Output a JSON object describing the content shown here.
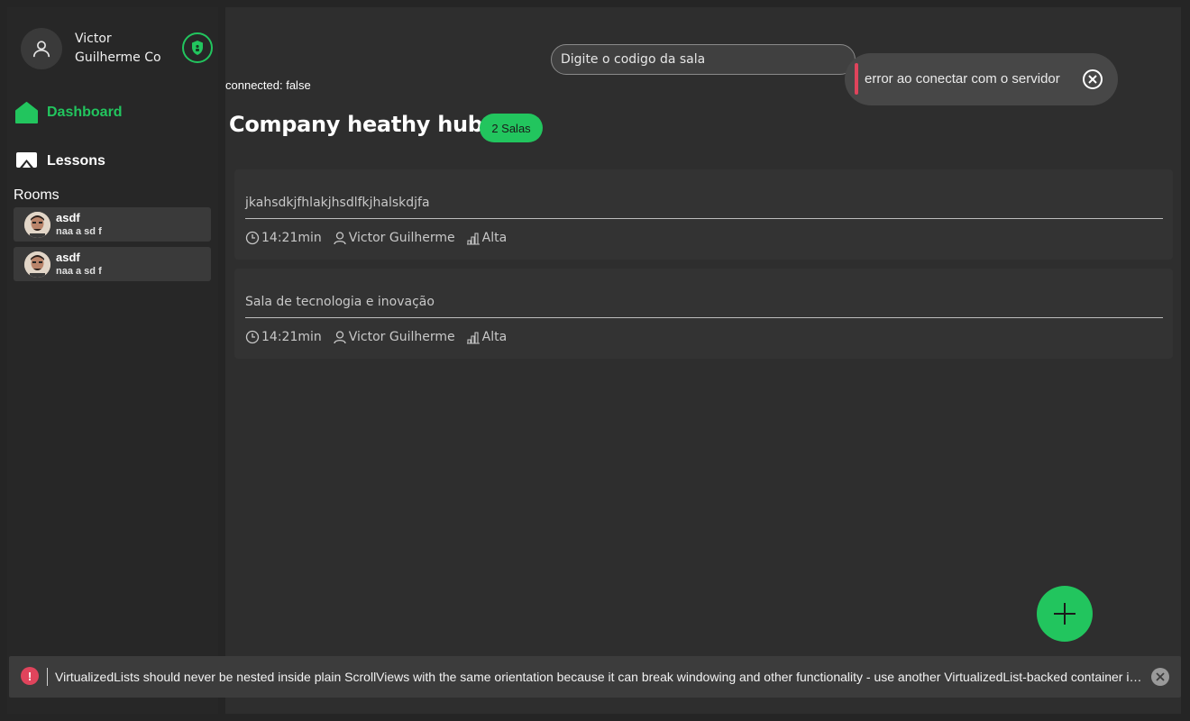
{
  "user": {
    "name": "Victor Guilherme Co"
  },
  "nav": {
    "dashboard": "Dashboard",
    "lessons": "Lessons"
  },
  "rooms": {
    "title": "Rooms",
    "items": [
      {
        "name": "asdf",
        "subtitle": "naa a sd f"
      },
      {
        "name": "asdf",
        "subtitle": "naa a sd f"
      }
    ]
  },
  "search": {
    "placeholder": "Digite o codigo da sala"
  },
  "status": {
    "connected": "connected: false"
  },
  "header": {
    "title": "Company heathy hub",
    "badge": "2 Salas"
  },
  "room_list": [
    {
      "title": "jkahsdkjfhlakjhsdlfkjhalskdjfa",
      "time": "14:21min",
      "owner": "Victor Guilherme",
      "level": "Alta"
    },
    {
      "title": "Sala de tecnologia e inovação",
      "time": "14:21min",
      "owner": "Victor Guilherme",
      "level": "Alta"
    }
  ],
  "toast": {
    "message": "error ao conectar com o servidor"
  },
  "warning": {
    "message": "VirtualizedLists should never be nested inside plain ScrollViews with the same orientation because it can break windowing and other functionality - use another VirtualizedList-backed container in..."
  },
  "colors": {
    "accent": "#22c55e",
    "error": "#e0445c",
    "background": "#2e2e2e"
  }
}
